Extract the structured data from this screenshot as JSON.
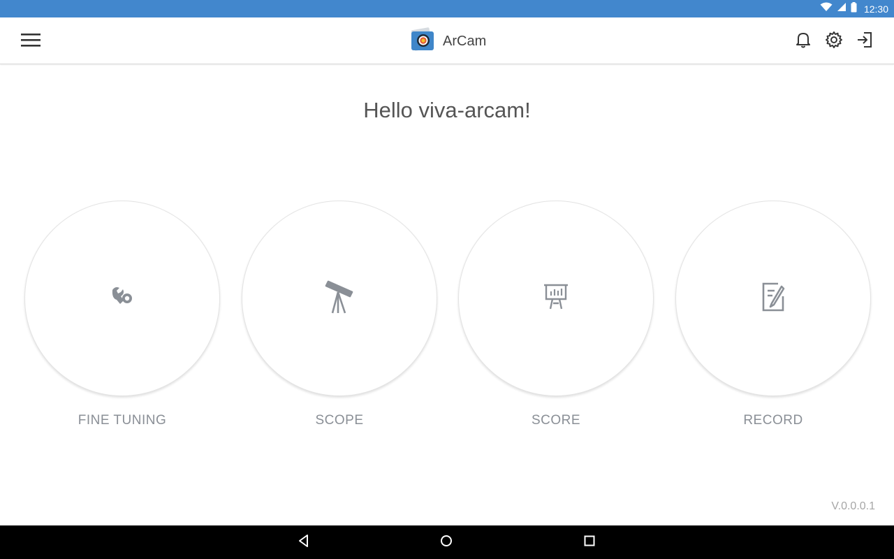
{
  "status_bar": {
    "time": "12:30",
    "icons": [
      "wifi-icon",
      "cell-signal-icon",
      "battery-icon"
    ],
    "color": "#4287cd"
  },
  "app_bar": {
    "title": "ArCam",
    "menu_icon": "hamburger-menu-icon",
    "actions": [
      "bell-icon",
      "gear-icon",
      "sign-in-icon"
    ]
  },
  "greeting": "Hello viva-arcam!",
  "tiles": [
    {
      "label": "FINE TUNING",
      "icon": "tools-icon"
    },
    {
      "label": "SCOPE",
      "icon": "telescope-icon"
    },
    {
      "label": "SCORE",
      "icon": "presentation-chart-icon"
    },
    {
      "label": "RECORD",
      "icon": "edit-document-icon"
    }
  ],
  "version": "V.0.0.0.1",
  "nav_bar": {
    "buttons": [
      "back-icon",
      "home-icon",
      "recents-icon"
    ]
  }
}
